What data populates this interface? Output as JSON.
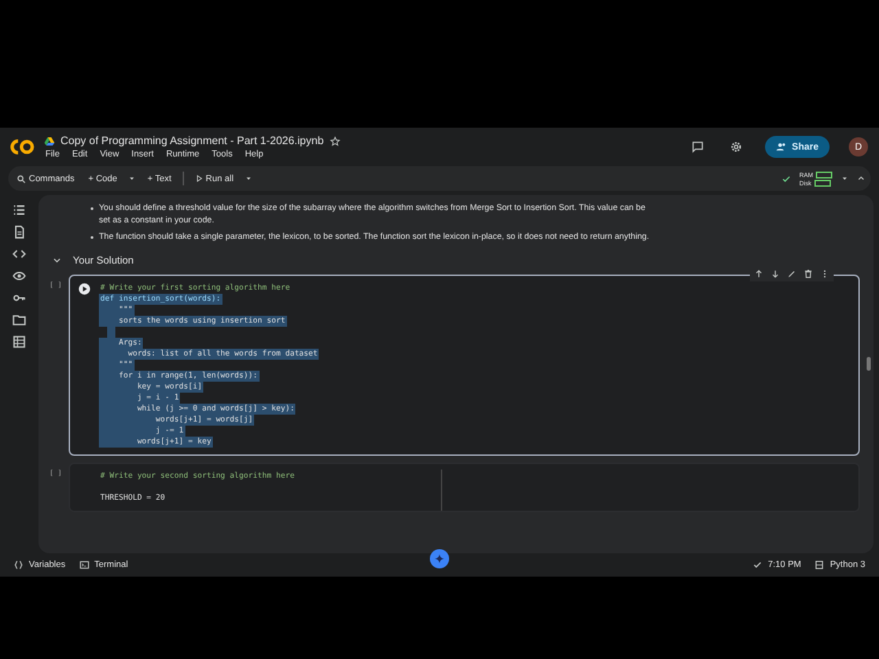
{
  "header": {
    "title": "Copy of Programming Assignment - Part 1-2026.ipynb",
    "starred": false,
    "menu": [
      "File",
      "Edit",
      "View",
      "Insert",
      "Runtime",
      "Tools",
      "Help"
    ],
    "share": "Share",
    "avatar": "D"
  },
  "toolbar": {
    "commands": "Commands",
    "add_code": "+ Code",
    "add_text": "+ Text",
    "run_all": "Run all",
    "ram": "RAM",
    "disk": "Disk"
  },
  "text_cell": {
    "bullets": [
      "You should define a threshold value for the size of the subarray where the algorithm switches from Merge Sort to Insertion Sort. This value can be set as a constant in your code.",
      "The function should take a single parameter, the lexicon, to be sorted. The function sort the lexicon in-place, so it does not need to return anything."
    ]
  },
  "section": {
    "title": "Your Solution",
    "expanded": true
  },
  "cells": [
    {
      "bracket": "[ ]",
      "focused": true,
      "lines": [
        {
          "text": "# Write your first sorting algorithm here",
          "kind": "comment",
          "selected": false
        },
        {
          "text": "def insertion_sort(words):",
          "kind": "def",
          "selected": true
        },
        {
          "text": "    \"\"\"",
          "kind": "code",
          "selected": true
        },
        {
          "text": "    sorts the words using insertion sort",
          "kind": "code",
          "selected": true
        },
        {
          "kind": "blank",
          "selected": true
        },
        {
          "text": "    Args:",
          "kind": "code",
          "selected": true
        },
        {
          "text": "      words: list of all the words from dataset",
          "kind": "code",
          "selected": true
        },
        {
          "text": "    \"\"\"",
          "kind": "code",
          "selected": true
        },
        {
          "text": "    for i in range(1, len(words)):",
          "kind": "code",
          "selected": true
        },
        {
          "text": "        key = words[i]",
          "kind": "code",
          "selected": true
        },
        {
          "text": "        j = i - 1",
          "kind": "code",
          "selected": true
        },
        {
          "text": "        while (j >= 0 and words[j] > key):",
          "kind": "code",
          "selected": true
        },
        {
          "text": "            words[j+1] = words[j]",
          "kind": "code",
          "selected": true
        },
        {
          "text": "            j -= 1",
          "kind": "code",
          "selected": true
        },
        {
          "text": "        words[j+1] = key",
          "kind": "code",
          "selected": true
        }
      ]
    },
    {
      "bracket": "[ ]",
      "focused": false,
      "lines": [
        {
          "text": "# Write your second sorting algorithm here",
          "kind": "comment",
          "selected": false
        },
        {
          "kind": "blank"
        },
        {
          "text": "THRESHOLD = 20",
          "kind": "code",
          "selected": false
        }
      ]
    }
  ],
  "status_bar": {
    "variables": "Variables",
    "terminal": "Terminal",
    "time": "7:10 PM",
    "runtime": "Python 3"
  }
}
